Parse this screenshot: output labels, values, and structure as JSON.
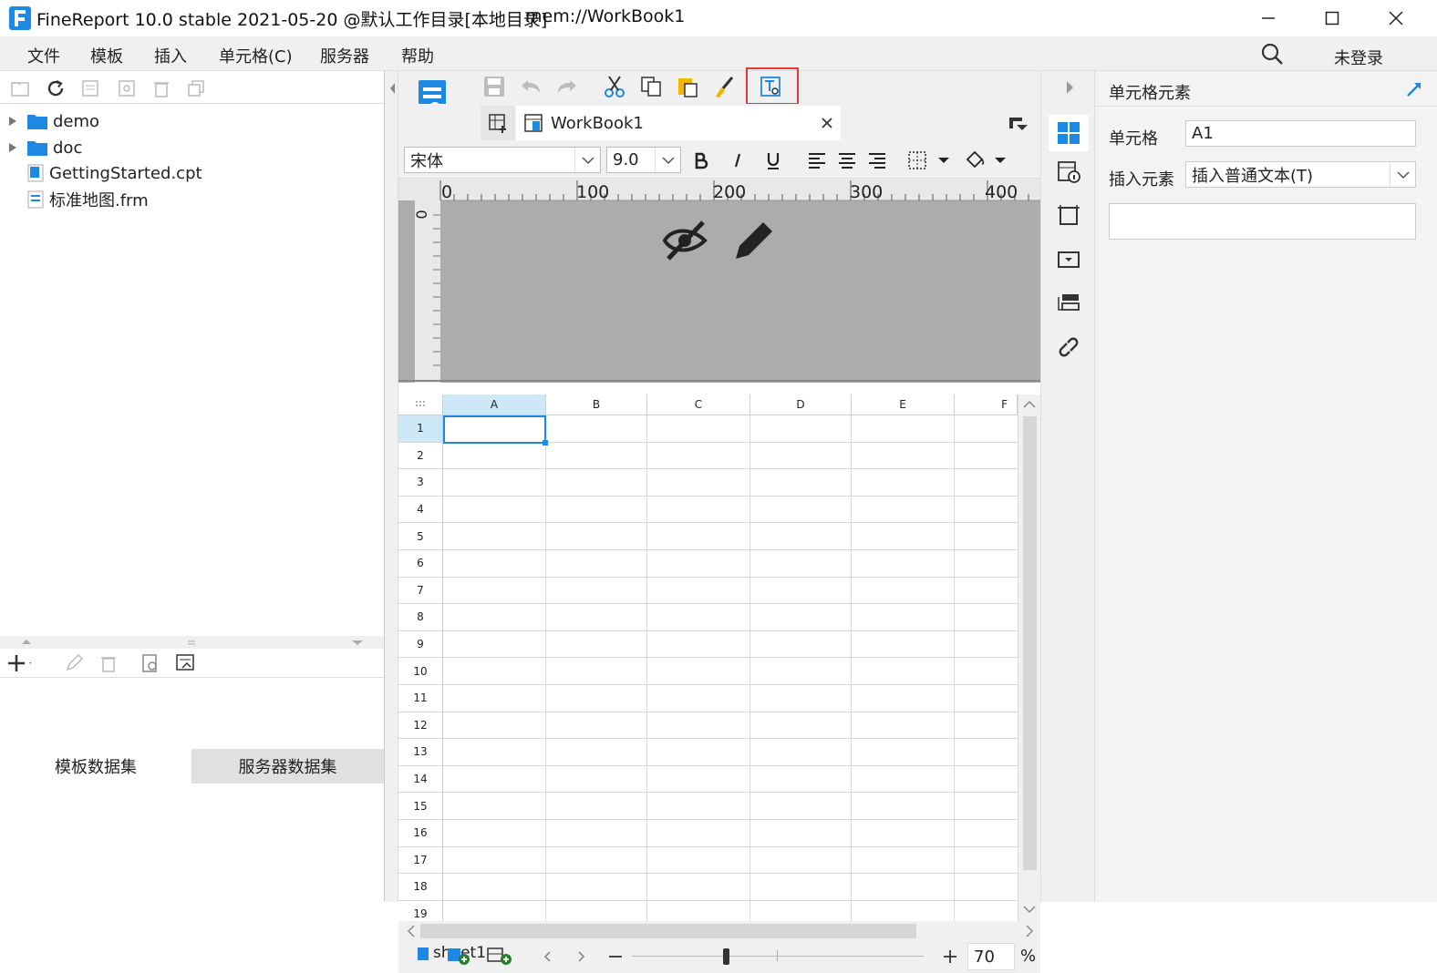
{
  "titlebar": {
    "title": "FineReport 10.0 stable 2021-05-20 @默认工作目录[本地目录]",
    "path": "mem://WorkBook1"
  },
  "menu": {
    "items": [
      "文件",
      "模板",
      "插入",
      "单元格(C)",
      "服务器",
      "帮助"
    ],
    "login": "未登录"
  },
  "tree": {
    "items": [
      {
        "label": "demo",
        "type": "folder"
      },
      {
        "label": "doc",
        "type": "folder"
      },
      {
        "label": "GettingStarted.cpt",
        "type": "cpt"
      },
      {
        "label": "标准地图.frm",
        "type": "frm"
      }
    ]
  },
  "datasets": {
    "tabs": [
      "模板数据集",
      "服务器数据集"
    ],
    "active": 1
  },
  "editor": {
    "tab_title": "WorkBook1",
    "font_name": "宋体",
    "font_size": "9.0",
    "ruler_labels": [
      "0",
      "100",
      "200",
      "300",
      "400"
    ],
    "ruler_left": "0",
    "columns": [
      "A",
      "B",
      "C",
      "D",
      "E",
      "F"
    ],
    "rows": [
      "1",
      "2",
      "3",
      "4",
      "5",
      "6",
      "7",
      "8",
      "9",
      "10",
      "11",
      "12",
      "13",
      "14",
      "15",
      "16",
      "17",
      "18",
      "19"
    ],
    "selected_cell": "A1"
  },
  "bottom": {
    "sheet_name": "sheet1",
    "zoom_value": "70",
    "zoom_unit": "%"
  },
  "rightpanel": {
    "title": "单元格元素",
    "cell_label": "单元格",
    "cell_value": "A1",
    "insert_label": "插入元素",
    "insert_value": "插入普通文本(T)"
  },
  "colors": {
    "accent": "#1e88e5",
    "highlight_box": "#e53935",
    "selected_header": "#cde8f7"
  }
}
